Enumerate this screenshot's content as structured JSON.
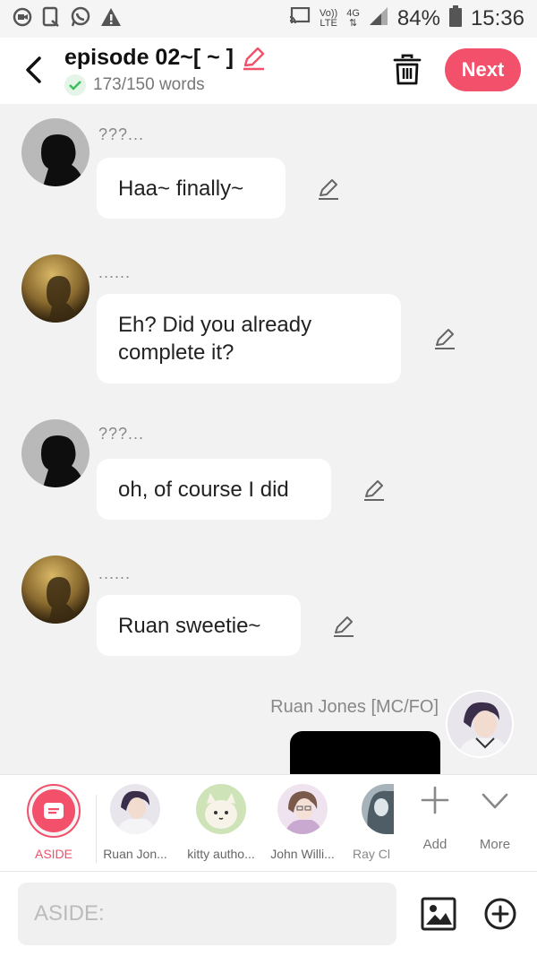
{
  "status_bar": {
    "volte": "Vo))",
    "lte": "LTE",
    "network": "4G",
    "battery": "84%",
    "time": "15:36"
  },
  "header": {
    "title": "episode 02~[ ~ ]",
    "word_count": "173/150 words",
    "next_label": "Next",
    "accent_color": "#f2506b"
  },
  "messages": [
    {
      "speaker": "???...",
      "text": "Haa~ finally~",
      "avatar": "dark-silhouette-avatar"
    },
    {
      "speaker": "......",
      "text": "Eh? Did you already complete it?",
      "avatar": "golden-silhouette-avatar"
    },
    {
      "speaker": "???...",
      "text": "oh, of course I did",
      "avatar": "dark-silhouette-avatar"
    },
    {
      "speaker": "......",
      "text": "Ruan sweetie~",
      "avatar": "golden-silhouette-avatar"
    }
  ],
  "right_message": {
    "speaker": "Ruan Jones [MC/FO]"
  },
  "characters": [
    {
      "label": "ASIDE"
    },
    {
      "label": "Ruan Jon..."
    },
    {
      "label": "kitty autho..."
    },
    {
      "label": "John Willi..."
    },
    {
      "label": "Ray Cl"
    }
  ],
  "tools": {
    "add_label": "Add",
    "more_label": "More"
  },
  "input": {
    "placeholder": "ASIDE:"
  }
}
